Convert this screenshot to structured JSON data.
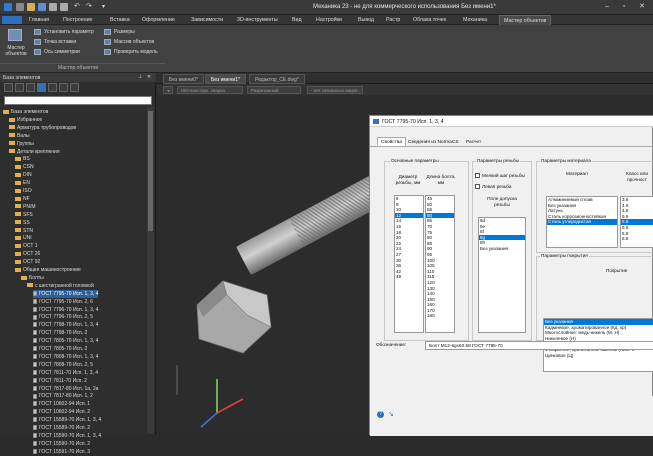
{
  "window": {
    "title": "Механика 23 - не для коммерческого использования Без имени1*"
  },
  "menu": {
    "tabs": [
      "Главная",
      "Построение",
      "Вставка",
      "Оформление",
      "Зависимости",
      "3D-инструменты",
      "Вид",
      "Настройки",
      "Вывод",
      "Растр",
      "Облака точек",
      "Механика",
      "Мастер объектов"
    ]
  },
  "ribbon": {
    "master_label": "Мастер объектов",
    "install_param": "Установить параметр",
    "insert_point": "Точка вставки",
    "symmetry_axis": "Ось симметрии",
    "sizes": "Размеры",
    "object_array": "Массив объектов",
    "check_model": "Проверить модель",
    "panel_label": "Мастер объектов"
  },
  "left_panel": {
    "title": "База элементов",
    "tree": [
      {
        "label": "База элементов",
        "kind": "folder",
        "indent": 0
      },
      {
        "label": "Избранное",
        "kind": "folder",
        "indent": 1
      },
      {
        "label": "Арматура трубопроводов",
        "kind": "folder",
        "indent": 1
      },
      {
        "label": "Валы",
        "kind": "folder",
        "indent": 1
      },
      {
        "label": "Группы",
        "kind": "folder",
        "indent": 1
      },
      {
        "label": "Детали крепления",
        "kind": "folder",
        "indent": 1
      },
      {
        "label": "BS",
        "kind": "folder",
        "indent": 2
      },
      {
        "label": "CSN",
        "kind": "folder",
        "indent": 2
      },
      {
        "label": "DIN",
        "kind": "folder",
        "indent": 2
      },
      {
        "label": "EN",
        "kind": "folder",
        "indent": 2
      },
      {
        "label": "ISO",
        "kind": "folder",
        "indent": 2
      },
      {
        "label": "NF",
        "kind": "folder",
        "indent": 2
      },
      {
        "label": "PN/M",
        "kind": "folder",
        "indent": 2
      },
      {
        "label": "SFS",
        "kind": "folder",
        "indent": 2
      },
      {
        "label": "SS",
        "kind": "folder",
        "indent": 2
      },
      {
        "label": "STN",
        "kind": "folder",
        "indent": 2
      },
      {
        "label": "UNI",
        "kind": "folder",
        "indent": 2
      },
      {
        "label": "ОСТ 1",
        "kind": "folder",
        "indent": 2
      },
      {
        "label": "ОСТ 26",
        "kind": "folder",
        "indent": 2
      },
      {
        "label": "ОСТ 92",
        "kind": "folder",
        "indent": 2
      },
      {
        "label": "Общее машиностроение",
        "kind": "folder",
        "indent": 2
      },
      {
        "label": "Болты",
        "kind": "folder",
        "indent": 3
      },
      {
        "label": "с шестигранной головкой",
        "kind": "folder",
        "indent": 4
      },
      {
        "label": "ГОСТ 7795-70 Исп. 1, 3, 4",
        "kind": "doc",
        "indent": 5,
        "selected": true
      },
      {
        "label": "ГОСТ 7795-70 Исп. 2, 6",
        "kind": "doc",
        "indent": 5
      },
      {
        "label": "ГОСТ 7796-70 Исп. 1, 3, 4",
        "kind": "doc",
        "indent": 5
      },
      {
        "label": "ГОСТ 7796-70 Исп. 2, 5",
        "kind": "doc",
        "indent": 5
      },
      {
        "label": "ГОСТ 7798-70 Исп. 1, 3, 4",
        "kind": "doc",
        "indent": 5
      },
      {
        "label": "ГОСТ 7798-70 Исп. 2",
        "kind": "doc",
        "indent": 5
      },
      {
        "label": "ГОСТ 7805-70 Исп. 1, 3, 4",
        "kind": "doc",
        "indent": 5
      },
      {
        "label": "ГОСТ 7805-70 Исп. 2",
        "kind": "doc",
        "indent": 5
      },
      {
        "label": "ГОСТ 7808-70 Исп. 1, 3, 4",
        "kind": "doc",
        "indent": 5
      },
      {
        "label": "ГОСТ 7808-70 Исп. 2, 5",
        "kind": "doc",
        "indent": 5
      },
      {
        "label": "ГОСТ 7811-70 Исп. 1, 3, 4",
        "kind": "doc",
        "indent": 5
      },
      {
        "label": "ГОСТ 7811-70 Исп. 2",
        "kind": "doc",
        "indent": 5
      },
      {
        "label": "ГОСТ 7817-80 Исп. 1а, 2а",
        "kind": "doc",
        "indent": 5
      },
      {
        "label": "ГОСТ 7817-80 Исп. 1, 2",
        "kind": "doc",
        "indent": 5
      },
      {
        "label": "ГОСТ 10602-94 Исп. 1",
        "kind": "doc",
        "indent": 5
      },
      {
        "label": "ГОСТ 10602-94 Исп. 2",
        "kind": "doc",
        "indent": 5
      },
      {
        "label": "ГОСТ 15589-70 Исп. 1, 3, 4",
        "kind": "doc",
        "indent": 5
      },
      {
        "label": "ГОСТ 15589-70 Исп. 2",
        "kind": "doc",
        "indent": 5
      },
      {
        "label": "ГОСТ 15590-70 Исп. 1, 3, 4",
        "kind": "doc",
        "indent": 5
      },
      {
        "label": "ГОСТ 15590-70 Исп. 2",
        "kind": "doc",
        "indent": 5
      },
      {
        "label": "ГОСТ 15591-70 Исп. 3",
        "kind": "doc",
        "indent": 5
      }
    ]
  },
  "doc_tabs": [
    "Без имени0*",
    "Без имени1*",
    "Редактор_СЕ.dwg*"
  ],
  "filter_bar": {
    "combo1": "ISO-конструк. сварка",
    "combo2": "Разрезанный",
    "combo3": "- нет связанных видов -"
  },
  "dialog": {
    "title": "ГОСТ 7795-70 Исп. 1, 3, 4",
    "tabs": [
      "Свойства",
      "Сведения из NormaCS",
      "Расчет"
    ],
    "basic_params": {
      "title": "Основные параметры",
      "col1": "Диаметр резьбы, мм",
      "col2": "Длина болта, мм",
      "diameters": [
        "6",
        "8",
        "10",
        "12",
        "14",
        "16",
        "18",
        "20",
        "22",
        "24",
        "27",
        "30",
        "36",
        "42",
        "48"
      ],
      "diameter_selected": "12",
      "lengths": [
        "45",
        "50",
        "55",
        "60",
        "65",
        "70",
        "75",
        "80",
        "85",
        "90",
        "95",
        "100",
        "105",
        "110",
        "115",
        "120",
        "130",
        "140",
        "150",
        "160",
        "170",
        "180"
      ],
      "length_selected": "60"
    },
    "thread_params": {
      "title": "Параметры резьбы",
      "fine_pitch": "Мелкий шаг резьбы",
      "left_thread": "Левая резьба",
      "tolerance_title": "Поле допуска резьбы",
      "tolerances": [
        "6d",
        "6e",
        "6f",
        "6g",
        "8h",
        "Без указания"
      ],
      "tolerance_selected": "6g"
    },
    "material_params": {
      "title": "Параметры материала",
      "col1": "Материал",
      "col2": "Класс или прочност",
      "materials": [
        "Алюминиевый сплав",
        "Без указания",
        "Латунь",
        "Сталь коррозионностойкая",
        "Сталь углеродистая"
      ],
      "material_selected": "Сталь углеродистая",
      "classes": [
        "3.6",
        "4.6",
        "4.8",
        "5.6",
        "5.8",
        "6.6",
        "6.8",
        "8.8"
      ],
      "class_selected": "5.8"
    },
    "coating_params": {
      "title": "Параметры покрытия",
      "col": "Покрытие",
      "coatings": [
        "Без указания",
        "Кадмиевое, хроматированное (Кд. хр)",
        "Многослойное: медь-никель (М. Н)",
        "Никелевое (Н)",
        "Окисное, пропитанное маслом (Хим. Окс",
        "Фосфатное, пропитанное маслом (Хим. Ф",
        "Цинковое (Ц)"
      ],
      "coating_selected": "Без указания"
    },
    "designation_label": "Обозначение:",
    "designation_value": "Болт М12-6gx60.58 ГОСТ 7795-70"
  }
}
